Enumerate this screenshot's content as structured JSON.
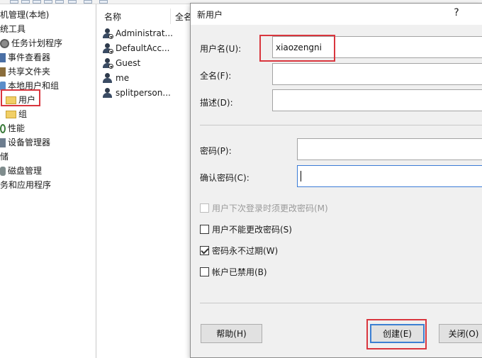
{
  "tree": {
    "items": [
      {
        "label": "机管理(本地)",
        "icon": "computer-icon"
      },
      {
        "label": "统工具",
        "icon": "tools-icon"
      },
      {
        "label": "任务计划程序",
        "icon": "clock-icon"
      },
      {
        "label": "事件查看器",
        "icon": "event-viewer-icon"
      },
      {
        "label": "共享文件夹",
        "icon": "shared-folder-icon"
      },
      {
        "label": "本地用户和组",
        "icon": "users-groups-icon"
      },
      {
        "label": "用户",
        "icon": "folder-icon"
      },
      {
        "label": "组",
        "icon": "folder-icon"
      },
      {
        "label": "性能",
        "icon": "performance-icon"
      },
      {
        "label": "设备管理器",
        "icon": "device-manager-icon"
      },
      {
        "label": "储",
        "icon": "storage-icon"
      },
      {
        "label": "磁盘管理",
        "icon": "disk-icon"
      },
      {
        "label": "务和应用程序",
        "icon": "services-icon"
      }
    ]
  },
  "list": {
    "col_name": "名称",
    "col_fullname": "全名",
    "users": [
      "Administrat...",
      "DefaultAcc...",
      "Guest",
      "me",
      "splitperson..."
    ]
  },
  "dialog": {
    "title": "新用户",
    "help_q": "?",
    "username_label": "用户名(U):",
    "username_value": "xiaozengni",
    "fullname_label": "全名(F):",
    "desc_label": "描述(D):",
    "password_label": "密码(P):",
    "confirm_label": "确认密码(C):",
    "opt_must_change": "用户下次登录时须更改密码(M)",
    "opt_cannot_change": "用户不能更改密码(S)",
    "opt_never_expires": "密码永不过期(W)",
    "opt_disabled": "帐户已禁用(B)",
    "help_button": "帮助(H)",
    "create_button": "创建(E)",
    "close_button": "关闭(O)"
  },
  "colors": {
    "highlight_box": "#d9363e",
    "focus_blue": "#3b7bd6"
  }
}
